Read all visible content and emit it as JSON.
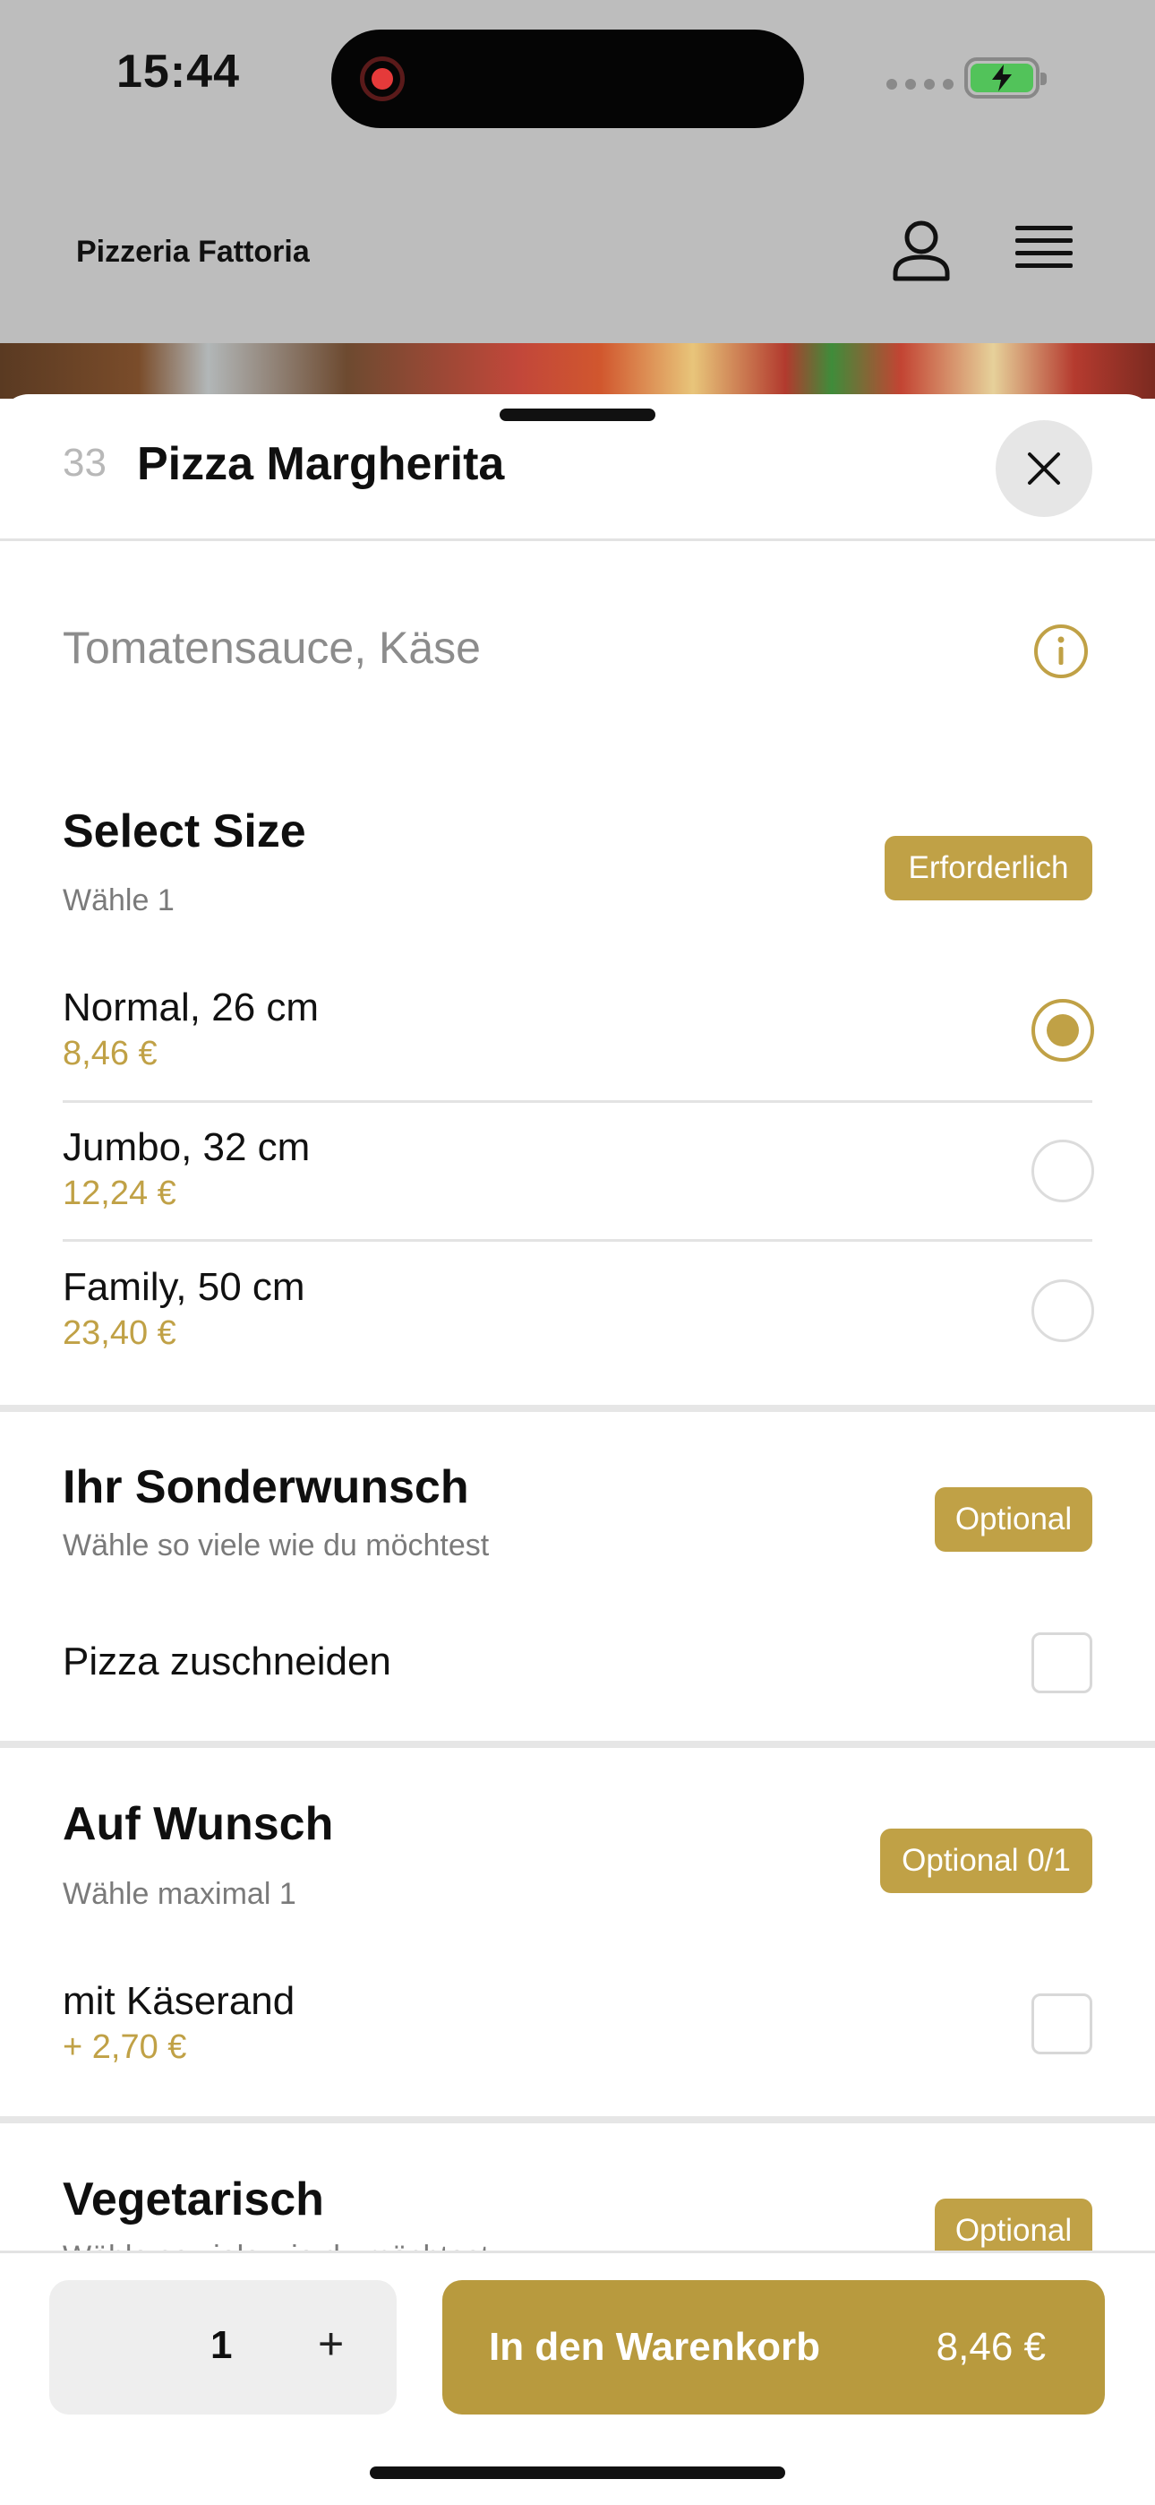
{
  "status_bar": {
    "time": "15:44"
  },
  "header": {
    "brand": "Pizzeria Fattoria"
  },
  "item": {
    "number": "33",
    "title": "Pizza Margherita",
    "description": "Tomatensauce, Käse"
  },
  "sections": [
    {
      "title": "Select Size",
      "subtitle": "Wähle 1",
      "badge": "Erforderlich",
      "options": [
        {
          "label": "Normal, 26 cm",
          "price": "8,46 €",
          "selected": true
        },
        {
          "label": "Jumbo, 32 cm",
          "price": "12,24 €",
          "selected": false
        },
        {
          "label": "Family, 50 cm",
          "price": "23,40 €",
          "selected": false
        }
      ]
    },
    {
      "title": "Ihr Sonderwunsch",
      "subtitle": "Wähle so viele wie du möchtest",
      "badge": "Optional",
      "options": [
        {
          "label": "Pizza zuschneiden",
          "checked": false
        }
      ]
    },
    {
      "title": "Auf Wunsch",
      "subtitle": "Wähle maximal 1",
      "badge": "Optional 0/1",
      "options": [
        {
          "label": "mit Käserand",
          "price": "+ 2,70 €",
          "checked": false
        }
      ]
    },
    {
      "title": "Vegetarisch",
      "subtitle": "Wähle so viele wie du möchtest",
      "badge": "Optional"
    }
  ],
  "footer": {
    "quantity": "1",
    "plus": "+",
    "cart_label": "In den Warenkorb",
    "cart_price": "8,46 €"
  },
  "colors": {
    "accent": "#c0a146"
  }
}
